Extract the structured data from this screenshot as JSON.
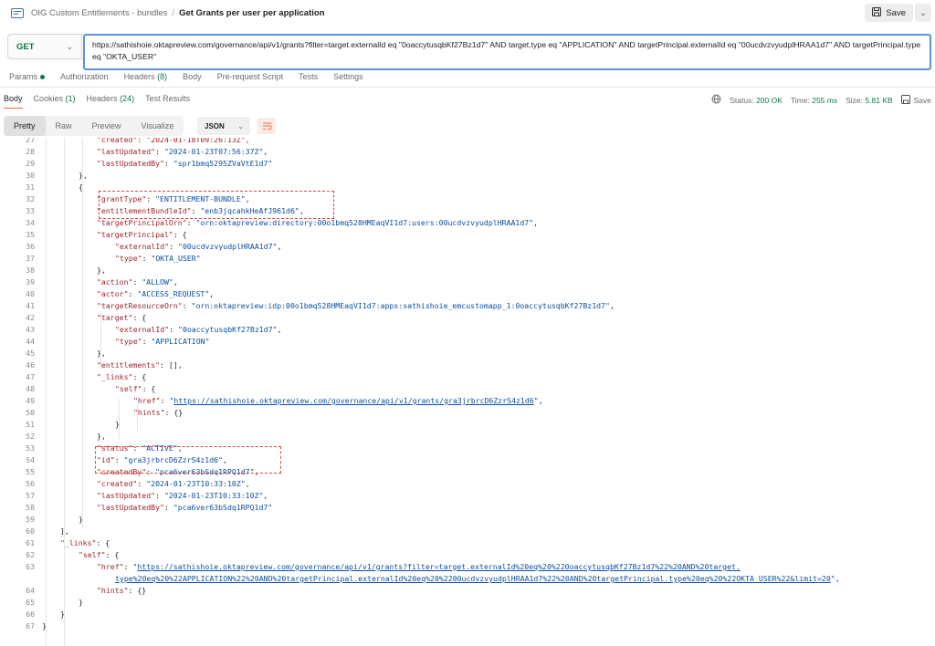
{
  "breadcrumb": {
    "collection": "OIG Custom Entitlements - bundles",
    "separator": "/",
    "request": "Get Grants per user per application"
  },
  "save": {
    "label": "Save"
  },
  "request": {
    "method": "GET",
    "url": "https://sathishoie.oktapreview.com/governance/api/v1/grants?filter=target.externalId eq \"0oaccytusqbKf27Bz1d7\" AND target.type eq \"APPLICATION\" AND targetPrincipal.externalId eq \"00ucdvzvyudplHRAA1d7\" AND targetPrincipal.type eq \"OKTA_USER\""
  },
  "request_tabs": [
    {
      "label": "Params",
      "count": ""
    },
    {
      "label": "Authorization",
      "count": ""
    },
    {
      "label": "Headers",
      "count": "(8)"
    },
    {
      "label": "Body",
      "count": ""
    },
    {
      "label": "Pre-request Script",
      "count": ""
    },
    {
      "label": "Tests",
      "count": ""
    },
    {
      "label": "Settings",
      "count": ""
    }
  ],
  "response_tabs": [
    {
      "label": "Body",
      "count": ""
    },
    {
      "label": "Cookies",
      "count": "(1)"
    },
    {
      "label": "Headers",
      "count": "(24)"
    },
    {
      "label": "Test Results",
      "count": ""
    }
  ],
  "status": {
    "status_label": "Status:",
    "status_value": "200 OK",
    "time_label": "Time:",
    "time_value": "255 ms",
    "size_label": "Size:",
    "size_value": "5.81 KB",
    "save_label": "Save"
  },
  "view_modes": [
    "Pretty",
    "Raw",
    "Preview",
    "Visualize"
  ],
  "format": {
    "label": "JSON"
  },
  "colors": {
    "accent": "#f26b3a",
    "success": "#0b7a48",
    "highlight": "#e0453a",
    "link": "#0b4fa3"
  },
  "code_lines": [
    {
      "n": "27",
      "i": 3,
      "t": [
        [
          "k",
          "\"created\": \"2024-01-18T09:26:13Z\","
        ]
      ]
    },
    {
      "n": "28",
      "i": 3,
      "t": [
        [
          "k",
          "\"lastUpdated\""
        ],
        [
          "p",
          ": "
        ],
        [
          "s",
          "\"2024-01-23T07:56:37Z\""
        ],
        [
          "p",
          ","
        ]
      ]
    },
    {
      "n": "29",
      "i": 3,
      "t": [
        [
          "k",
          "\"lastUpdatedBy\""
        ],
        [
          "p",
          ": "
        ],
        [
          "s",
          "\"spr1bmq5295ZVaVtE1d7\""
        ]
      ]
    },
    {
      "n": "30",
      "i": 2,
      "t": [
        [
          "p",
          "},"
        ]
      ]
    },
    {
      "n": "31",
      "i": 2,
      "t": [
        [
          "p",
          "{"
        ]
      ]
    },
    {
      "n": "32",
      "i": 3,
      "t": [
        [
          "k",
          "\"grantType\""
        ],
        [
          "p",
          ": "
        ],
        [
          "s",
          "\"ENTITLEMENT-BUNDLE\""
        ],
        [
          "p",
          ","
        ]
      ]
    },
    {
      "n": "33",
      "i": 3,
      "t": [
        [
          "k",
          "\"entitlementBundleId\""
        ],
        [
          "p",
          ": "
        ],
        [
          "s",
          "\"enb3jqcahkHeAfJ961d6\""
        ],
        [
          "p",
          ","
        ]
      ]
    },
    {
      "n": "34",
      "i": 3,
      "t": [
        [
          "k",
          "\"targetPrincipalOrn\""
        ],
        [
          "p",
          ": "
        ],
        [
          "s",
          "\"orn:oktapreview:directory:00o1bmq528HMEaqVI1d7:users:00ucdvzvyudplHRAA1d7\""
        ],
        [
          "p",
          ","
        ]
      ]
    },
    {
      "n": "35",
      "i": 3,
      "t": [
        [
          "k",
          "\"targetPrincipal\""
        ],
        [
          "p",
          ": {"
        ]
      ]
    },
    {
      "n": "36",
      "i": 4,
      "t": [
        [
          "k",
          "\"externalId\""
        ],
        [
          "p",
          ": "
        ],
        [
          "s",
          "\"00ucdvzvyudplHRAA1d7\""
        ],
        [
          "p",
          ","
        ]
      ]
    },
    {
      "n": "37",
      "i": 4,
      "t": [
        [
          "k",
          "\"type\""
        ],
        [
          "p",
          ": "
        ],
        [
          "s",
          "\"OKTA_USER\""
        ]
      ]
    },
    {
      "n": "38",
      "i": 3,
      "t": [
        [
          "p",
          "},"
        ]
      ]
    },
    {
      "n": "39",
      "i": 3,
      "t": [
        [
          "k",
          "\"action\""
        ],
        [
          "p",
          ": "
        ],
        [
          "s",
          "\"ALLOW\""
        ],
        [
          "p",
          ","
        ]
      ]
    },
    {
      "n": "40",
      "i": 3,
      "t": [
        [
          "k",
          "\"actor\""
        ],
        [
          "p",
          ": "
        ],
        [
          "s",
          "\"ACCESS_REQUEST\""
        ],
        [
          "p",
          ","
        ]
      ]
    },
    {
      "n": "41",
      "i": 3,
      "t": [
        [
          "k",
          "\"targetResourceOrn\""
        ],
        [
          "p",
          ": "
        ],
        [
          "s",
          "\"orn:oktapreview:idp:00o1bmq528HMEaqVI1d7:apps:sathishoie_emcustomapp_1:0oaccytusqbKf27Bz1d7\""
        ],
        [
          "p",
          ","
        ]
      ]
    },
    {
      "n": "42",
      "i": 3,
      "t": [
        [
          "k",
          "\"target\""
        ],
        [
          "p",
          ": {"
        ]
      ]
    },
    {
      "n": "43",
      "i": 4,
      "t": [
        [
          "k",
          "\"externalId\""
        ],
        [
          "p",
          ": "
        ],
        [
          "s",
          "\"0oaccytusqbKf27Bz1d7\""
        ],
        [
          "p",
          ","
        ]
      ]
    },
    {
      "n": "44",
      "i": 4,
      "t": [
        [
          "k",
          "\"type\""
        ],
        [
          "p",
          ": "
        ],
        [
          "s",
          "\"APPLICATION\""
        ]
      ]
    },
    {
      "n": "45",
      "i": 3,
      "t": [
        [
          "p",
          "},"
        ]
      ]
    },
    {
      "n": "46",
      "i": 3,
      "t": [
        [
          "k",
          "\"entitlements\""
        ],
        [
          "p",
          ": [],"
        ]
      ]
    },
    {
      "n": "47",
      "i": 3,
      "t": [
        [
          "k",
          "\"_links\""
        ],
        [
          "p",
          ": {"
        ]
      ]
    },
    {
      "n": "48",
      "i": 4,
      "t": [
        [
          "k",
          "\"self\""
        ],
        [
          "p",
          ": {"
        ]
      ]
    },
    {
      "n": "49",
      "i": 5,
      "t": [
        [
          "k",
          "\"href\""
        ],
        [
          "p",
          ": "
        ],
        [
          "s",
          "\""
        ],
        [
          "u",
          "https://sathishoie.oktapreview.com/governance/api/v1/grants/gra3jrbrcD6ZzrS4z1d6"
        ],
        [
          "s",
          "\""
        ],
        [
          "p",
          ","
        ]
      ]
    },
    {
      "n": "50",
      "i": 5,
      "t": [
        [
          "k",
          "\"hints\""
        ],
        [
          "p",
          ": {}"
        ]
      ]
    },
    {
      "n": "51",
      "i": 4,
      "t": [
        [
          "p",
          "}"
        ]
      ]
    },
    {
      "n": "52",
      "i": 3,
      "t": [
        [
          "p",
          "},"
        ]
      ]
    },
    {
      "n": "53",
      "i": 3,
      "t": [
        [
          "k",
          "\"status\""
        ],
        [
          "p",
          ": "
        ],
        [
          "s",
          "\"ACTIVE\""
        ],
        [
          "p",
          ","
        ]
      ]
    },
    {
      "n": "54",
      "i": 3,
      "t": [
        [
          "k",
          "\"id\""
        ],
        [
          "p",
          ": "
        ],
        [
          "s",
          "\"gra3jrbrcD6ZzrS4z1d6\""
        ],
        [
          "p",
          ","
        ]
      ]
    },
    {
      "n": "55",
      "i": 3,
      "t": [
        [
          "k",
          "\"createdBy\""
        ],
        [
          "p",
          ": "
        ],
        [
          "s",
          "\"pca6ver63bSdq1RPQ1d7\""
        ],
        [
          "p",
          ","
        ]
      ]
    },
    {
      "n": "56",
      "i": 3,
      "t": [
        [
          "k",
          "\"created\""
        ],
        [
          "p",
          ": "
        ],
        [
          "s",
          "\"2024-01-23T10:33:10Z\""
        ],
        [
          "p",
          ","
        ]
      ]
    },
    {
      "n": "57",
      "i": 3,
      "t": [
        [
          "k",
          "\"lastUpdated\""
        ],
        [
          "p",
          ": "
        ],
        [
          "s",
          "\"2024-01-23T10:33:10Z\""
        ],
        [
          "p",
          ","
        ]
      ]
    },
    {
      "n": "58",
      "i": 3,
      "t": [
        [
          "k",
          "\"lastUpdatedBy\""
        ],
        [
          "p",
          ": "
        ],
        [
          "s",
          "\"pca6ver63bSdq1RPQ1d7\""
        ]
      ]
    },
    {
      "n": "59",
      "i": 2,
      "t": [
        [
          "p",
          "}"
        ]
      ]
    },
    {
      "n": "60",
      "i": 1,
      "t": [
        [
          "p",
          "],"
        ]
      ]
    },
    {
      "n": "61",
      "i": 1,
      "t": [
        [
          "k",
          "\"_links\""
        ],
        [
          "p",
          ": {"
        ]
      ]
    },
    {
      "n": "62",
      "i": 2,
      "t": [
        [
          "k",
          "\"self\""
        ],
        [
          "p",
          ": {"
        ]
      ]
    },
    {
      "n": "63",
      "i": 3,
      "t": [
        [
          "k",
          "\"href\""
        ],
        [
          "p",
          ": "
        ],
        [
          "s",
          "\""
        ],
        [
          "u",
          "https://sathishoie.oktapreview.com/governance/api/v1/grants?filter=target.externalId%20eq%20%220oaccytusqbKf27Bz1d7%22%20AND%20target."
        ]
      ]
    },
    {
      "n": "",
      "i": 4,
      "t": [
        [
          "u",
          "type%20eq%20%22APPLICATION%22%20AND%20targetPrincipal.externalId%20eq%20%2200ucdvzvyudplHRAA1d7%22%20AND%20targetPrincipal.type%20eq%20%22OKTA_USER%22&limit=20"
        ],
        [
          "s",
          "\""
        ],
        [
          "p",
          ","
        ]
      ]
    },
    {
      "n": "64",
      "i": 3,
      "t": [
        [
          "k",
          "\"hints\""
        ],
        [
          "p",
          ": {}"
        ]
      ]
    },
    {
      "n": "65",
      "i": 2,
      "t": [
        [
          "p",
          "}"
        ]
      ]
    },
    {
      "n": "66",
      "i": 1,
      "t": [
        [
          "p",
          "}"
        ]
      ]
    },
    {
      "n": "67",
      "i": 0,
      "t": [
        [
          "p",
          "}"
        ]
      ]
    }
  ]
}
